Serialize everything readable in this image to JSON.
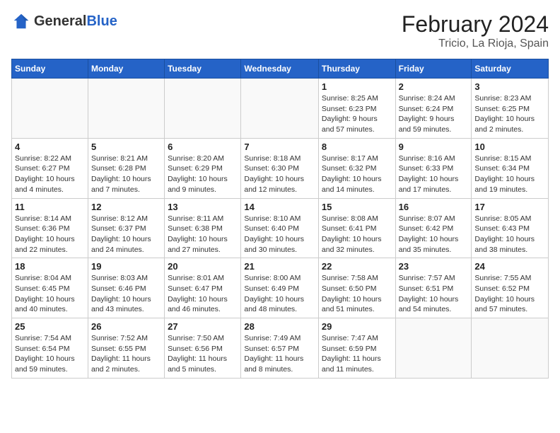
{
  "header": {
    "logo_general": "General",
    "logo_blue": "Blue",
    "title": "February 2024",
    "subtitle": "Tricio, La Rioja, Spain"
  },
  "weekdays": [
    "Sunday",
    "Monday",
    "Tuesday",
    "Wednesday",
    "Thursday",
    "Friday",
    "Saturday"
  ],
  "weeks": [
    [
      {
        "day": "",
        "info": ""
      },
      {
        "day": "",
        "info": ""
      },
      {
        "day": "",
        "info": ""
      },
      {
        "day": "",
        "info": ""
      },
      {
        "day": "1",
        "info": "Sunrise: 8:25 AM\nSunset: 6:23 PM\nDaylight: 9 hours\nand 57 minutes."
      },
      {
        "day": "2",
        "info": "Sunrise: 8:24 AM\nSunset: 6:24 PM\nDaylight: 9 hours\nand 59 minutes."
      },
      {
        "day": "3",
        "info": "Sunrise: 8:23 AM\nSunset: 6:25 PM\nDaylight: 10 hours\nand 2 minutes."
      }
    ],
    [
      {
        "day": "4",
        "info": "Sunrise: 8:22 AM\nSunset: 6:27 PM\nDaylight: 10 hours\nand 4 minutes."
      },
      {
        "day": "5",
        "info": "Sunrise: 8:21 AM\nSunset: 6:28 PM\nDaylight: 10 hours\nand 7 minutes."
      },
      {
        "day": "6",
        "info": "Sunrise: 8:20 AM\nSunset: 6:29 PM\nDaylight: 10 hours\nand 9 minutes."
      },
      {
        "day": "7",
        "info": "Sunrise: 8:18 AM\nSunset: 6:30 PM\nDaylight: 10 hours\nand 12 minutes."
      },
      {
        "day": "8",
        "info": "Sunrise: 8:17 AM\nSunset: 6:32 PM\nDaylight: 10 hours\nand 14 minutes."
      },
      {
        "day": "9",
        "info": "Sunrise: 8:16 AM\nSunset: 6:33 PM\nDaylight: 10 hours\nand 17 minutes."
      },
      {
        "day": "10",
        "info": "Sunrise: 8:15 AM\nSunset: 6:34 PM\nDaylight: 10 hours\nand 19 minutes."
      }
    ],
    [
      {
        "day": "11",
        "info": "Sunrise: 8:14 AM\nSunset: 6:36 PM\nDaylight: 10 hours\nand 22 minutes."
      },
      {
        "day": "12",
        "info": "Sunrise: 8:12 AM\nSunset: 6:37 PM\nDaylight: 10 hours\nand 24 minutes."
      },
      {
        "day": "13",
        "info": "Sunrise: 8:11 AM\nSunset: 6:38 PM\nDaylight: 10 hours\nand 27 minutes."
      },
      {
        "day": "14",
        "info": "Sunrise: 8:10 AM\nSunset: 6:40 PM\nDaylight: 10 hours\nand 30 minutes."
      },
      {
        "day": "15",
        "info": "Sunrise: 8:08 AM\nSunset: 6:41 PM\nDaylight: 10 hours\nand 32 minutes."
      },
      {
        "day": "16",
        "info": "Sunrise: 8:07 AM\nSunset: 6:42 PM\nDaylight: 10 hours\nand 35 minutes."
      },
      {
        "day": "17",
        "info": "Sunrise: 8:05 AM\nSunset: 6:43 PM\nDaylight: 10 hours\nand 38 minutes."
      }
    ],
    [
      {
        "day": "18",
        "info": "Sunrise: 8:04 AM\nSunset: 6:45 PM\nDaylight: 10 hours\nand 40 minutes."
      },
      {
        "day": "19",
        "info": "Sunrise: 8:03 AM\nSunset: 6:46 PM\nDaylight: 10 hours\nand 43 minutes."
      },
      {
        "day": "20",
        "info": "Sunrise: 8:01 AM\nSunset: 6:47 PM\nDaylight: 10 hours\nand 46 minutes."
      },
      {
        "day": "21",
        "info": "Sunrise: 8:00 AM\nSunset: 6:49 PM\nDaylight: 10 hours\nand 48 minutes."
      },
      {
        "day": "22",
        "info": "Sunrise: 7:58 AM\nSunset: 6:50 PM\nDaylight: 10 hours\nand 51 minutes."
      },
      {
        "day": "23",
        "info": "Sunrise: 7:57 AM\nSunset: 6:51 PM\nDaylight: 10 hours\nand 54 minutes."
      },
      {
        "day": "24",
        "info": "Sunrise: 7:55 AM\nSunset: 6:52 PM\nDaylight: 10 hours\nand 57 minutes."
      }
    ],
    [
      {
        "day": "25",
        "info": "Sunrise: 7:54 AM\nSunset: 6:54 PM\nDaylight: 10 hours\nand 59 minutes."
      },
      {
        "day": "26",
        "info": "Sunrise: 7:52 AM\nSunset: 6:55 PM\nDaylight: 11 hours\nand 2 minutes."
      },
      {
        "day": "27",
        "info": "Sunrise: 7:50 AM\nSunset: 6:56 PM\nDaylight: 11 hours\nand 5 minutes."
      },
      {
        "day": "28",
        "info": "Sunrise: 7:49 AM\nSunset: 6:57 PM\nDaylight: 11 hours\nand 8 minutes."
      },
      {
        "day": "29",
        "info": "Sunrise: 7:47 AM\nSunset: 6:59 PM\nDaylight: 11 hours\nand 11 minutes."
      },
      {
        "day": "",
        "info": ""
      },
      {
        "day": "",
        "info": ""
      }
    ]
  ]
}
